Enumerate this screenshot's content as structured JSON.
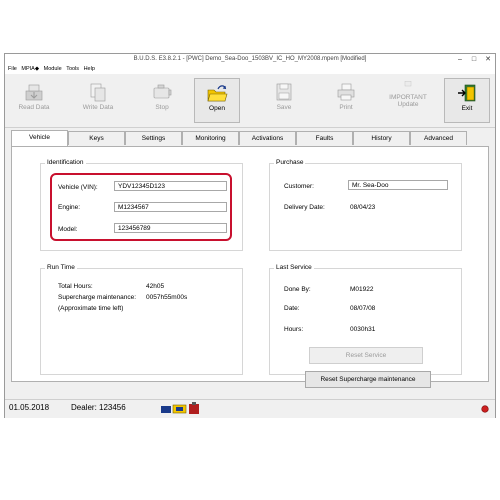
{
  "window": {
    "title": "B.U.D.S. E3.8.2.1 - [PWC] Demo_Sea-Doo_1503BV_IC_HO_MY2008.mpem [Modified]",
    "controls": [
      "–",
      "□",
      "✕"
    ]
  },
  "menu": [
    "File",
    "MPIA◆",
    "Module",
    "Tools",
    "Help"
  ],
  "toolbar": {
    "read_data": "Read Data",
    "write_data": "Write Data",
    "stop": "Stop",
    "open": "Open",
    "save": "Save",
    "print": "Print",
    "important_update": "IMPORTANT\nUpdate",
    "important_line1": "IMPORTANT",
    "important_line2": "Update",
    "exit": "Exit"
  },
  "tabs": [
    "Vehicle",
    "Keys",
    "Settings",
    "Monitoring",
    "Activations",
    "Faults",
    "History",
    "Advanced"
  ],
  "identification": {
    "title": "Identification",
    "vin_label": "Vehicle (VIN):",
    "vin_value": "YDV12345D123",
    "engine_label": "Engine:",
    "engine_value": "M1234567",
    "model_label": "Model:",
    "model_value": "123456789"
  },
  "purchase": {
    "title": "Purchase",
    "customer_label": "Customer:",
    "customer_value": "Mr. Sea-Doo",
    "delivery_label": "Delivery Date:",
    "delivery_value": "08/04/23"
  },
  "runtime": {
    "title": "Run Time",
    "total_hours_label": "Total Hours:",
    "total_hours_value": "42h05",
    "supercharge_label": "Supercharge maintenance:",
    "supercharge_value": "0057h55m00s",
    "note": "(Approximate time left)"
  },
  "last_service": {
    "title": "Last Service",
    "done_by_label": "Done By:",
    "done_by_value": "M01922",
    "date_label": "Date:",
    "date_value": "08/07/08",
    "hours_label": "Hours:",
    "hours_value": "0030h31",
    "reset_service": "Reset Service",
    "reset_supercharge": "Reset Supercharge maintenance"
  },
  "status": {
    "date": "01.05.2018",
    "dealer": "Dealer: 123456"
  },
  "colors": {
    "highlight": "#c8102e",
    "status_led": "#cc2020"
  }
}
